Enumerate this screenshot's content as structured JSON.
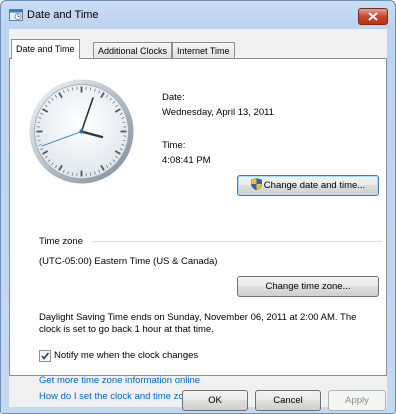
{
  "window": {
    "title": "Date and Time"
  },
  "tabs": [
    {
      "label": "Date and Time",
      "active": true
    },
    {
      "label": "Additional Clocks",
      "active": false
    },
    {
      "label": "Internet Time",
      "active": false
    }
  ],
  "datetime": {
    "date_label": "Date:",
    "date_value": "Wednesday, April 13, 2011",
    "time_label": "Time:",
    "time_value": "4:08:41 PM",
    "change_button": "Change date and time..."
  },
  "timezone": {
    "section_label": "Time zone",
    "value": "(UTC-05:00) Eastern Time (US & Canada)",
    "change_button": "Change time zone..."
  },
  "dst": {
    "line1": "Daylight Saving Time ends on Sunday, November 06, 2011 at 2:00 AM. The",
    "line2": "clock is set to go back 1 hour at that time."
  },
  "notify": {
    "label": "Notify me when the clock changes",
    "checked": true
  },
  "links": {
    "more_info": "Get more time zone information online",
    "how_set": "How do I set the clock and time zone?"
  },
  "footer": {
    "ok": "OK",
    "cancel": "Cancel",
    "apply": "Apply"
  },
  "colors": {
    "link": "#0066cc",
    "title_bar": "#bcd3ee",
    "close_button": "#c9452c"
  }
}
